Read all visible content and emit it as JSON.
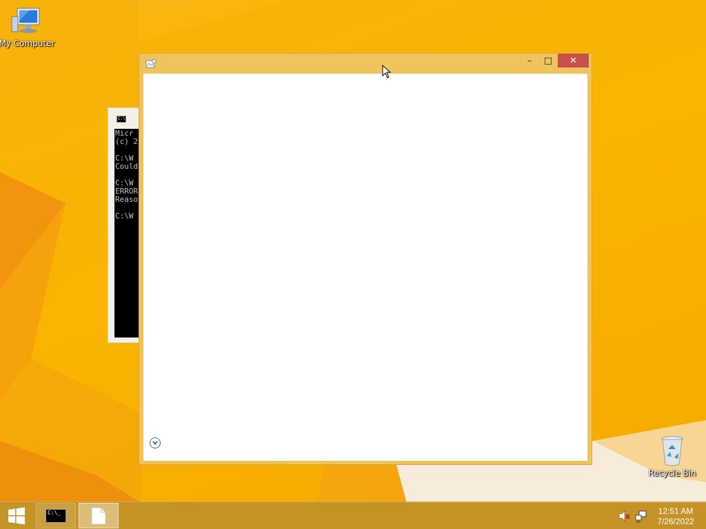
{
  "desktop": {
    "icons": [
      {
        "label": "My Computer",
        "icon": "computer-icon"
      },
      {
        "label": "Recycle Bin",
        "icon": "recycle-bin-icon"
      }
    ]
  },
  "console_window": {
    "icon": "console-icon",
    "icon_text": "C:\\",
    "lines": [
      "Micr",
      "(c) 2",
      "",
      "C:\\W",
      "Could",
      "",
      "C:\\W",
      "ERROR",
      "Reaso",
      "",
      "C:\\W"
    ]
  },
  "main_window": {
    "title": "",
    "buttons": {
      "minimize": "–",
      "maximize": "□",
      "close": "✕"
    },
    "expand_icon": "chevron-down-icon"
  },
  "taskbar": {
    "start_icon": "windows-logo-icon",
    "items": [
      {
        "name": "Command Prompt",
        "icon": "console-icon",
        "glyph": "C:\\_"
      },
      {
        "name": "Document",
        "icon": "document-icon"
      }
    ],
    "tray": {
      "volume_icon": "volume-muted-icon",
      "network_icon": "network-icon"
    },
    "clock": {
      "time": "12:51 AM",
      "date": "7/26/2022"
    }
  },
  "colors": {
    "wallpaper": "#f9b500",
    "window_frame": "#f0c45c",
    "close_button": "#c7504b",
    "taskbar": "#ba8c2e"
  }
}
